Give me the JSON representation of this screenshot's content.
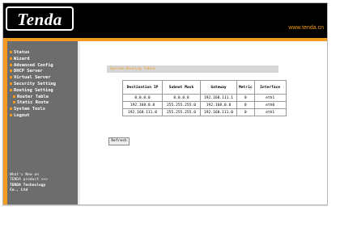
{
  "header": {
    "logo_text": "Tenda",
    "site_url": "www.tenda.cn"
  },
  "sidebar": {
    "items": [
      {
        "label": "Status",
        "sub": false
      },
      {
        "label": "Wizard",
        "sub": false
      },
      {
        "label": "Advanced Config",
        "sub": false
      },
      {
        "label": "DHCP Server",
        "sub": false
      },
      {
        "label": "Virtual Server",
        "sub": false
      },
      {
        "label": "Security Setting",
        "sub": false
      },
      {
        "label": "Routing Setting",
        "sub": false
      },
      {
        "label": "Router Table",
        "sub": true
      },
      {
        "label": "Static Route",
        "sub": true
      },
      {
        "label": "System Tools",
        "sub": false
      },
      {
        "label": "Logout",
        "sub": false
      }
    ],
    "note_line1": "What's New on",
    "note_line2": "TENDA product >>>",
    "note_line3": "TENDA Technology",
    "note_line4": "Co., Ltd"
  },
  "main": {
    "section_title": "System Routing Table",
    "refresh_label": "Refresh",
    "table": {
      "headers": [
        "Destination IP",
        "Subnet Mask",
        "Gateway",
        "Metric",
        "Interface"
      ],
      "rows": [
        [
          "0.0.0.0",
          "0.0.0.0",
          "192.168.111.1",
          "0",
          "eth1"
        ],
        [
          "192.168.0.0",
          "255.255.255.0",
          "192.168.0.0",
          "0",
          "eth0"
        ],
        [
          "192.168.111.0",
          "255.255.255.0",
          "192.168.111.0",
          "0",
          "eth1"
        ]
      ]
    }
  },
  "colors": {
    "accent_orange": "#f39b1e",
    "header_black": "#000000",
    "sidebar_gray": "#6d6d6d"
  }
}
